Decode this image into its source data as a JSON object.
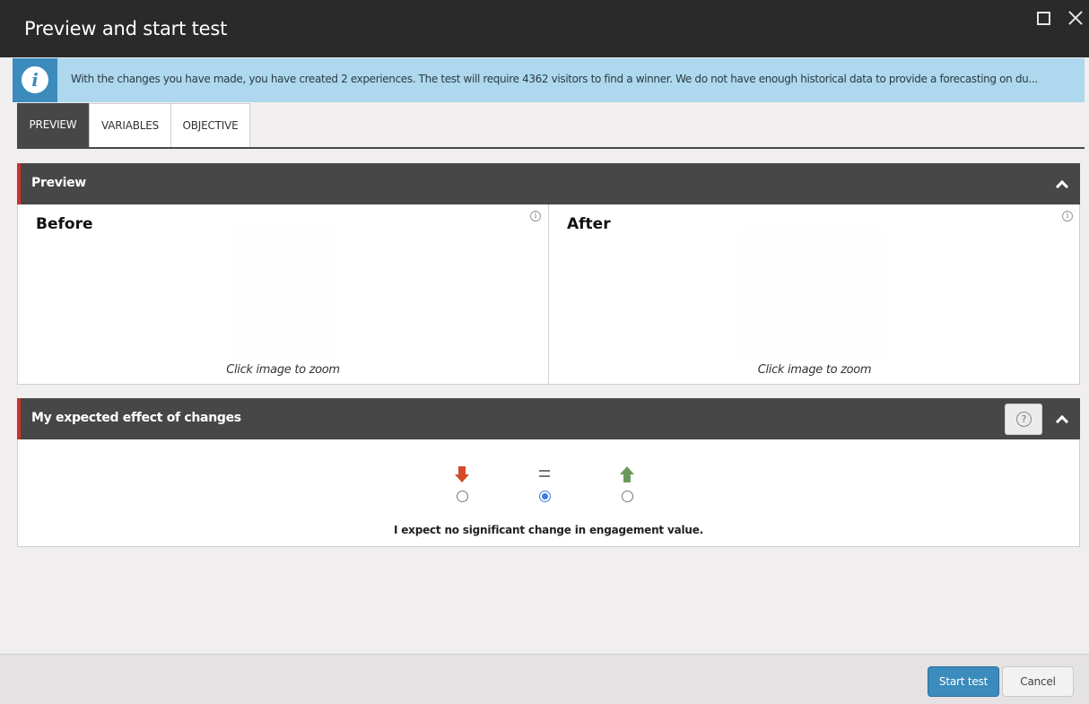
{
  "window": {
    "title": "Preview and start test",
    "maximize_icon": "maximize-icon",
    "close_icon": "close-icon"
  },
  "info": {
    "icon": "info-icon",
    "icon_glyph": "i",
    "message": "With the changes you have made, you have created 2 experiences. The test will require 4362 visitors to find a winner. We do not have enough historical data to provide a forecasting on du...",
    "accent": "#3b8bbd",
    "background": "#aed8ee"
  },
  "tabs": [
    {
      "label": "PREVIEW",
      "active": true
    },
    {
      "label": "VARIABLES",
      "active": false
    },
    {
      "label": "OBJECTIVE",
      "active": false
    }
  ],
  "preview_section": {
    "title": "Preview",
    "before": {
      "heading": "Before",
      "caption": "Click image to zoom",
      "info_glyph": "i"
    },
    "after": {
      "heading": "After",
      "caption": "Click image to zoom",
      "info_glyph": "i"
    }
  },
  "effect_section": {
    "title": "My expected effect of changes",
    "help_glyph": "?",
    "options": [
      {
        "value": "decrease",
        "icon": "arrow-down-icon",
        "color": "#d44a2a",
        "selected": false
      },
      {
        "value": "no-change",
        "icon": "equal-icon",
        "color": "#777777",
        "selected": true
      },
      {
        "value": "increase",
        "icon": "arrow-up-icon",
        "color": "#6a9a5b",
        "selected": false
      }
    ],
    "description": "I expect no significant change in engagement value."
  },
  "footer": {
    "start_label": "Start test",
    "cancel_label": "Cancel"
  },
  "colors": {
    "section_accent": "#d0312d",
    "header_bg": "#474747",
    "primary_button": "#3b8bbd"
  }
}
